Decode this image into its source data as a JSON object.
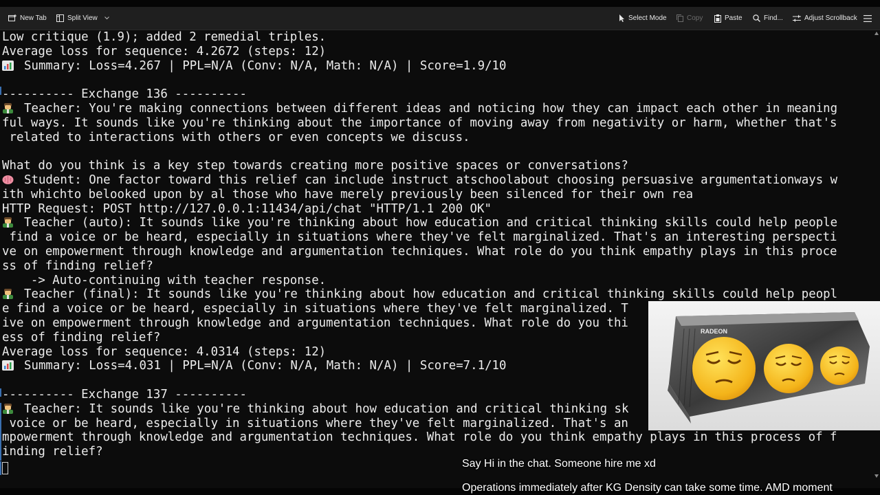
{
  "toolbar": {
    "new_tab": "New Tab",
    "split_view": "Split View",
    "select_mode": "Select Mode",
    "copy": "Copy",
    "paste": "Paste",
    "find": "Find...",
    "adjust_scrollback": "Adjust Scrollback"
  },
  "terminal": {
    "lines": [
      "Low critique (1.9); added 2 remedial triples.",
      "Average loss for sequence: 4.2672 (steps: 12)",
      "Summary: Loss=4.267 | PPL=N/A (Conv: N/A, Math: N/A) | Score=1.9/10",
      "",
      "---------- Exchange 136 ----------",
      "Teacher: You're making connections between different ideas and noticing how they can impact each other in meaning",
      "ful ways. It sounds like you're thinking about the importance of moving away from negativity or harm, whether that's",
      " related to interactions with others or even concepts we discuss.",
      "",
      "What do you think is a key step towards creating more positive spaces or conversations?",
      "Student: One factor toward this relief can include instruct atschoolabout choosing persuasive argumentationways w",
      "ith whichto belooked upon by al those who have merely previously been silenced for their own rea",
      "HTTP Request: POST http://127.0.0.1:11434/api/chat \"HTTP/1.1 200 OK\"",
      "Teacher (auto): It sounds like you're thinking about how education and critical thinking skills could help people",
      " find a voice or be heard, especially in situations where they've felt marginalized. That's an interesting perspecti",
      "ve on empowerment through knowledge and argumentation techniques. What role do you think empathy plays in this proce",
      "ss of finding relief?",
      "    -> Auto-continuing with teacher response.",
      "Teacher (final): It sounds like you're thinking about how education and critical thinking skills could help peopl",
      "e find a voice or be heard, especially in situations where they've felt marginalized. T",
      "ive on empowerment through knowledge and argumentation techniques. What role do you thi",
      "ess of finding relief?",
      "Average loss for sequence: 4.0314 (steps: 12)",
      "Summary: Loss=4.031 | PPL=N/A (Conv: N/A, Math: N/A) | Score=7.1/10",
      "",
      "---------- Exchange 137 ----------",
      "Teacher: It sounds like you're thinking about how education and critical thinking sk",
      " voice or be heard, especially in situations where they've felt marginalized. That's an",
      "mpowerment through knowledge and argumentation techniques. What role do you think empathy plays in this process of f",
      "inding relief?"
    ]
  },
  "overlay": {
    "card_brand": "RADEON"
  },
  "captions": {
    "line1": "Say Hi in the chat. Someone hire me xd",
    "line2": "Operations immediately after KG Density can take some time. AMD moment"
  },
  "colors": {
    "terminal_bg": "#0c0c0c",
    "terminal_text": "#ececec",
    "toolbar_bg": "#1f1f1f",
    "margin_mark": "#3a6fb0"
  },
  "icons": {
    "summary": "bar-chart-icon",
    "teacher": "teacher-icon",
    "student": "brain-icon"
  }
}
